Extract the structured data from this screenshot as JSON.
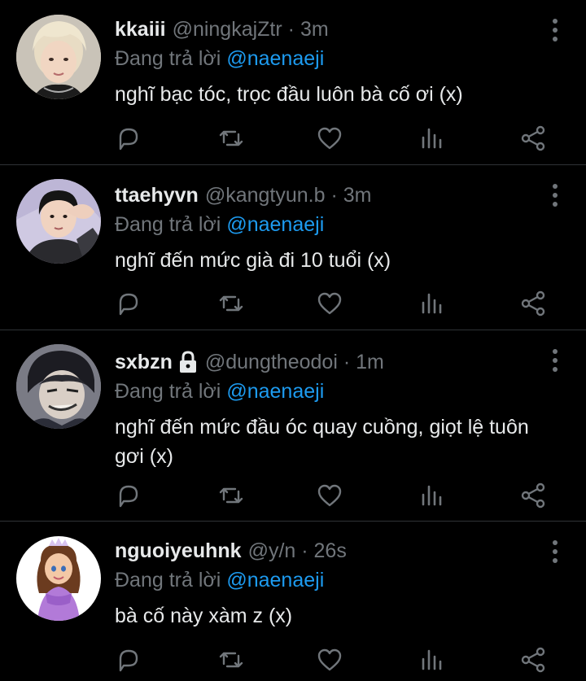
{
  "tweets": [
    {
      "name": "kkaiii",
      "handle": "@ningkajZtr",
      "time": "3m",
      "locked": false,
      "reply_prefix": "Đang trả lời",
      "reply_to": "@naenaeji",
      "text": "nghĩ bạc tóc, trọc đầu luôn bà cố ơi (x)",
      "avatar": "avatar-photo-blond"
    },
    {
      "name": "ttaehyvn",
      "handle": "@kangtyun.b",
      "time": "3m",
      "locked": false,
      "reply_prefix": "Đang trả lời",
      "reply_to": "@naenaeji",
      "text": "nghĩ đến mức già đi 10 tuổi (x)",
      "avatar": "avatar-photo-heart-pose"
    },
    {
      "name": "sxbzn",
      "handle": "@dungtheodoi",
      "time": "1m",
      "locked": true,
      "reply_prefix": "Đang trả lời",
      "reply_to": "@naenaeji",
      "text": "nghĩ đến mức đầu óc quay cuồng, giọt lệ tuôn gơi (x)",
      "avatar": "avatar-anime-character"
    },
    {
      "name": "nguoiyeuhnk",
      "handle": "@y/n",
      "time": "26s",
      "locked": false,
      "reply_prefix": "Đang trả lời",
      "reply_to": "@naenaeji",
      "text": "bà cố này xàm z (x)",
      "avatar": "avatar-cartoon-princess"
    }
  ],
  "icons": [
    "reply-icon",
    "retweet-icon",
    "like-icon",
    "views-icon",
    "share-icon",
    "more-icon",
    "lock-icon"
  ],
  "colors": {
    "background": "#000000",
    "text": "#e7e9ea",
    "muted": "#71767b",
    "link": "#1d9bf0",
    "divider": "#2f3336"
  }
}
